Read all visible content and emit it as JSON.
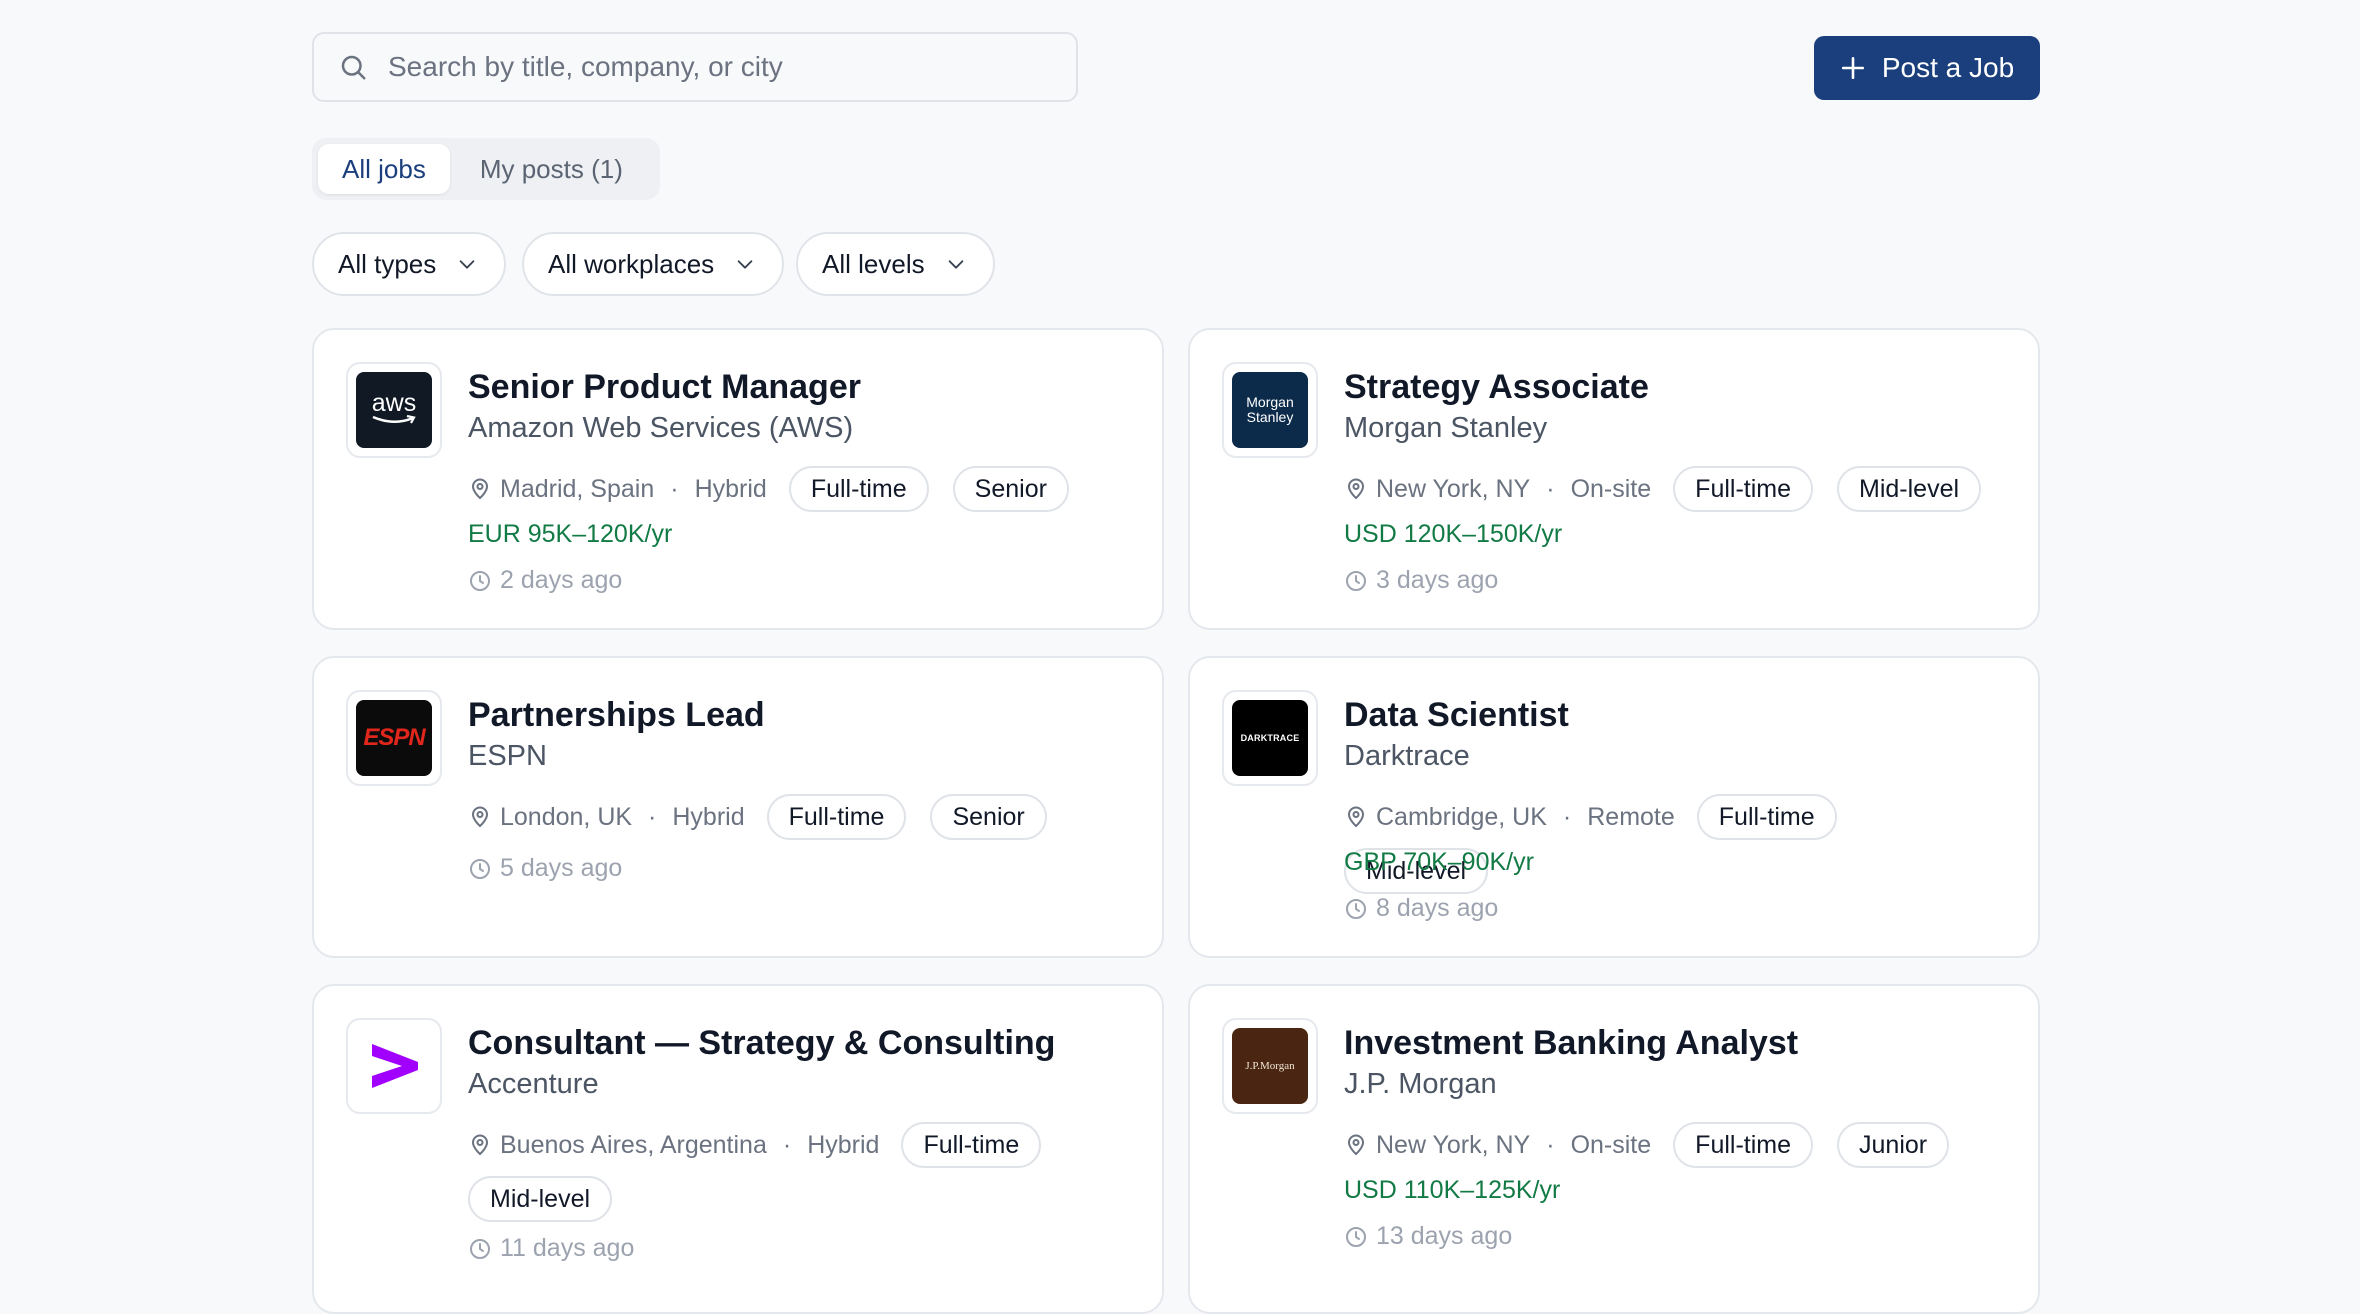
{
  "search": {
    "placeholder": "Search by title, company, or city"
  },
  "post_button": {
    "label": "Post a Job"
  },
  "tabs": [
    {
      "label": "All jobs",
      "active": true
    },
    {
      "label": "My posts (1)",
      "active": false
    }
  ],
  "filters": [
    {
      "label": "All types"
    },
    {
      "label": "All workplaces"
    },
    {
      "label": "All levels"
    }
  ],
  "colors": {
    "primary": "#1b3f7c",
    "salary": "#127a45"
  },
  "jobs": [
    {
      "title": "Senior Product Manager",
      "company": "Amazon Web Services (AWS)",
      "location": "Madrid, Spain",
      "workplace": "Hybrid",
      "type": "Full-time",
      "level": "Senior",
      "salary": "EUR 95K–120K/yr",
      "posted": "2 days ago",
      "logo": {
        "text": "aws",
        "icon": "aws-logo"
      }
    },
    {
      "title": "Strategy Associate",
      "company": "Morgan Stanley",
      "location": "New York, NY",
      "workplace": "On-site",
      "type": "Full-time",
      "level": "Mid-level",
      "salary": "USD 120K–150K/yr",
      "posted": "3 days ago",
      "logo": {
        "text1": "Morgan",
        "text2": "Stanley",
        "icon": "morgan-stanley-logo"
      }
    },
    {
      "title": "Partnerships Lead",
      "company": "ESPN",
      "location": "London, UK",
      "workplace": "Hybrid",
      "type": "Full-time",
      "level": "Senior",
      "salary": "",
      "posted": "5 days ago",
      "logo": {
        "text": "ESPN",
        "icon": "espn-logo"
      }
    },
    {
      "title": "Data Scientist",
      "company": "Darktrace",
      "location": "Cambridge, UK",
      "workplace": "Remote",
      "type": "Full-time",
      "level": "Mid-level",
      "salary": "GBP 70K–90K/yr",
      "posted": "8 days ago",
      "logo": {
        "text": "DARKTRACE",
        "icon": "darktrace-logo"
      }
    },
    {
      "title": "Consultant — Strategy & Consulting",
      "company": "Accenture",
      "location": "Buenos Aires, Argentina",
      "workplace": "Hybrid",
      "type": "Full-time",
      "level": "Mid-level",
      "salary": "",
      "posted": "11 days ago",
      "logo": {
        "icon": "accenture-logo"
      }
    },
    {
      "title": "Investment Banking Analyst",
      "company": "J.P. Morgan",
      "location": "New York, NY",
      "workplace": "On-site",
      "type": "Full-time",
      "level": "Junior",
      "salary": "USD 110K–125K/yr",
      "posted": "13 days ago",
      "logo": {
        "text": "J.P.Morgan",
        "icon": "jpmorgan-logo"
      }
    }
  ]
}
